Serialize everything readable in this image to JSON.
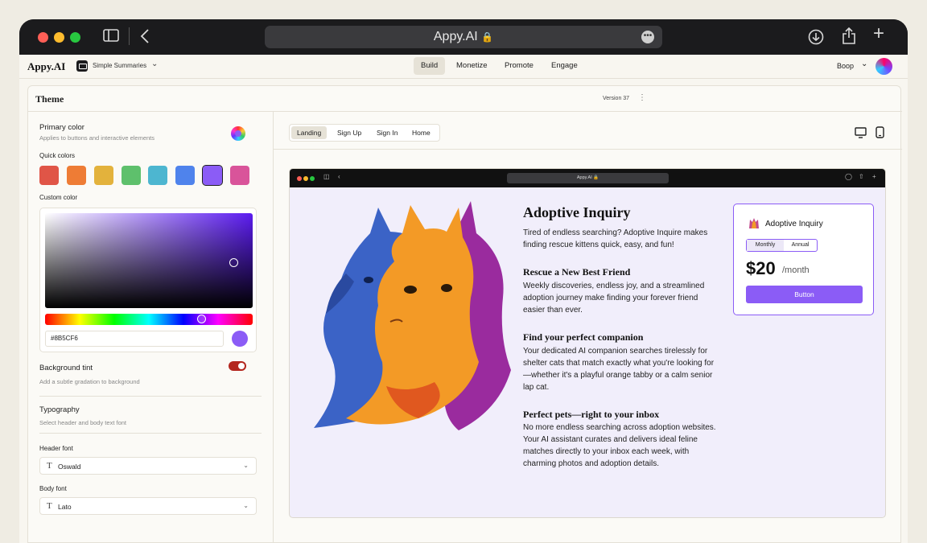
{
  "browser": {
    "address": "Appy.AI",
    "colors": {
      "close": "#ff5f57",
      "minimize": "#febc2e",
      "maximize": "#28c840"
    }
  },
  "appbar": {
    "logo": "Appy.AI",
    "project": "Simple Summaries",
    "tabs": [
      "Build",
      "Monetize",
      "Promote",
      "Engage"
    ],
    "active_tab": "Build",
    "user": "Boop"
  },
  "theme": {
    "title": "Theme",
    "version": "Version 37",
    "primary_color": {
      "label": "Primary color",
      "description": "Applies to buttons and interactive elements"
    },
    "quick_colors": {
      "label": "Quick colors",
      "swatches": [
        "#e05547",
        "#ee7c35",
        "#e3b23c",
        "#5ec06c",
        "#4db6d0",
        "#4f83ec",
        "#8B5CF6",
        "#d9549a"
      ],
      "selected": "#8B5CF6"
    },
    "custom_color": {
      "label": "Custom color",
      "hex": "#8B5CF6"
    },
    "background_tint": {
      "label": "Background tint",
      "description": "Add a subtle gradation to background",
      "enabled": true
    },
    "typography": {
      "label": "Typography",
      "description": "Select header and body text font"
    },
    "header_font": {
      "label": "Header font",
      "value": "Oswald",
      "icon": "T"
    },
    "body_font": {
      "label": "Body font",
      "value": "Lato",
      "icon": "T"
    }
  },
  "preview": {
    "pages": [
      "Landing",
      "Sign Up",
      "Sign In",
      "Home"
    ],
    "active_page": "Landing",
    "address": "Appy.AI",
    "headline": "Adoptive Inquiry",
    "intro": "Tired of endless searching? Adoptive Inquire makes finding rescue kittens quick, easy, and fun!",
    "sections": [
      {
        "title": "Rescue a New Best Friend",
        "body": "Weekly discoveries, endless joy, and a streamlined adoption journey make finding your forever friend easier than ever."
      },
      {
        "title": "Find your perfect companion",
        "body": "Your dedicated AI companion searches tirelessly for shelter cats that match exactly what you're looking for—whether it's a playful orange tabby or a calm senior lap cat."
      },
      {
        "title": "Perfect pets—right to your inbox",
        "body": "No more endless searching across adoption websites. Your AI assistant curates and delivers ideal feline matches directly to your inbox each week, with charming photos and adoption details."
      }
    ],
    "card": {
      "title": "Adoptive Inquiry",
      "billing": [
        "Monthly",
        "Annual"
      ],
      "selected_billing": "Monthly",
      "price": "$20",
      "period": "/month",
      "button": "Button"
    }
  }
}
